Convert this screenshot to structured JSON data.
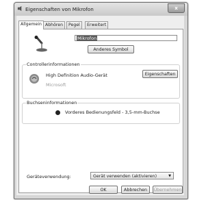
{
  "window": {
    "title": "Eigenschaften von Mikrofon",
    "close_symbol": "x"
  },
  "tabs": [
    {
      "label": "Allgemein",
      "active": true
    },
    {
      "label": "Abhören",
      "active": false
    },
    {
      "label": "Pegel",
      "active": false
    },
    {
      "label": "Erweitert",
      "active": false
    }
  ],
  "general": {
    "device_name": "Mikrofon",
    "change_icon_label": "Anderes Symbol"
  },
  "controller": {
    "group_label": "Controllerinformationen",
    "name": "High Definition Audio-Gerät",
    "vendor": "Microsoft",
    "properties_label": "Eigenschaften"
  },
  "jack": {
    "group_label": "Buchseninformationen",
    "description": "Vorderes Bedienungsfeld - 3,5-mm-Buchse"
  },
  "device_usage": {
    "label": "Geräteverwendung:",
    "selected": "Gerät verwenden (aktivieren)"
  },
  "buttons": {
    "ok": "OK",
    "cancel": "Abbrechen",
    "apply": "Übernehmen"
  }
}
